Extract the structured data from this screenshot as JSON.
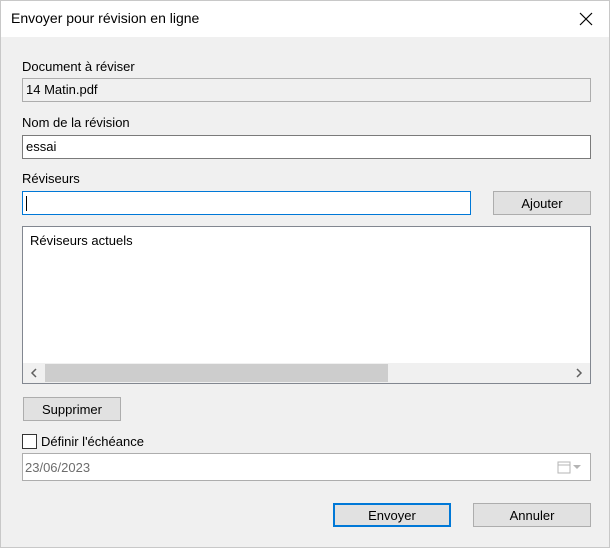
{
  "window": {
    "title": "Envoyer pour révision en ligne",
    "close_icon": "close-icon"
  },
  "document": {
    "label": "Document à réviser",
    "value": "14 Matin.pdf"
  },
  "review_name": {
    "label": "Nom de la révision",
    "value": "essai"
  },
  "reviewers": {
    "label": "Réviseurs",
    "value": "",
    "add_label": "Ajouter",
    "list_header": "Réviseurs actuels",
    "remove_label": "Supprimer"
  },
  "deadline": {
    "checkbox_label": "Définir l'échéance",
    "checked": false,
    "date_value": "23/06/2023",
    "calendar_icon": "calendar-icon"
  },
  "actions": {
    "send_label": "Envoyer",
    "cancel_label": "Annuler"
  },
  "colors": {
    "accent": "#0078d7",
    "dialog_bg": "#f0f0f0"
  }
}
